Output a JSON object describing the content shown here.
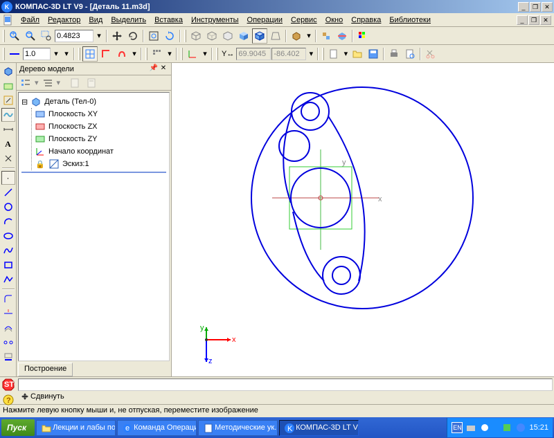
{
  "titlebar": {
    "app": "КОМПАС-3D LT V9",
    "doc": "[Деталь 11.m3d]"
  },
  "menu": [
    "Файл",
    "Редактор",
    "Вид",
    "Выделить",
    "Вставка",
    "Инструменты",
    "Операции",
    "Сервис",
    "Окно",
    "Справка",
    "Библиотеки"
  ],
  "toolbar": {
    "zoom_value": "0.4823",
    "scale_value": "1.0",
    "coord_x": "69.9045",
    "coord_y": "-86.402"
  },
  "tree": {
    "title": "Дерево модели",
    "root": "Деталь (Тел-0)",
    "items": [
      {
        "icon": "plane-blue",
        "label": "Плоскость XY"
      },
      {
        "icon": "plane-red",
        "label": "Плоскость ZX"
      },
      {
        "icon": "plane-green",
        "label": "Плоскость ZY"
      },
      {
        "icon": "origin",
        "label": "Начало координат"
      }
    ],
    "sketch": "Эскиз:1",
    "tab": "Построение"
  },
  "axes": {
    "x": "x",
    "y": "y",
    "z": "z"
  },
  "cursor_label": "Сдвинуть",
  "status": "Нажмите левую кнопку мыши и, не отпуская, переместите изображение",
  "taskbar": {
    "start": "Пуск",
    "items": [
      "Лекции и лабы по ...",
      "Команда Операци...",
      "Методические ук...",
      "КОМПАС-3D LT V..."
    ],
    "lang": "EN",
    "clock": "15:21"
  }
}
